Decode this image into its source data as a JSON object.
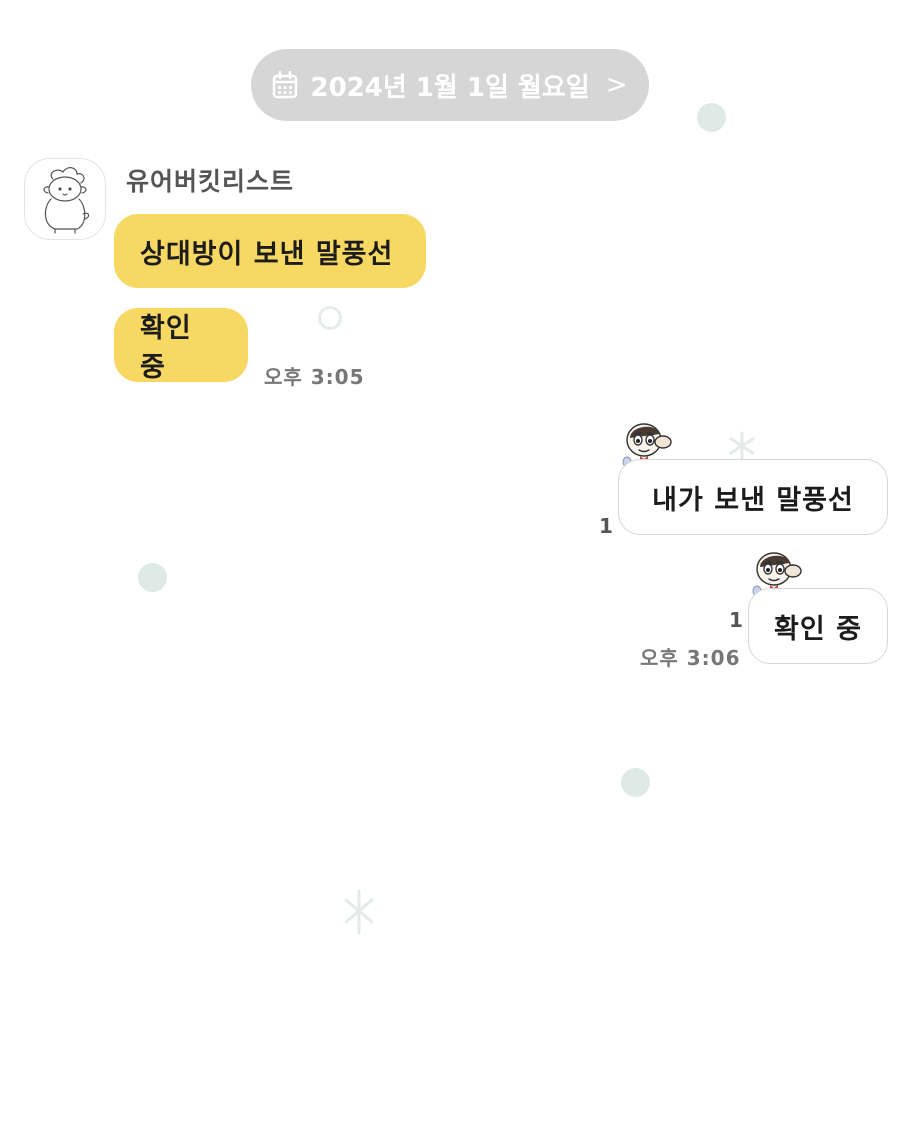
{
  "date_divider": {
    "label": "2024년 1월 1일 월요일",
    "chevron": ">",
    "icon": "calendar-icon",
    "bg_color": "#d6d6d6"
  },
  "incoming": {
    "sender_name": "유어버킷리스트",
    "avatar_icon": "sheep-sketch-avatar",
    "bubble_color": "#f6d862",
    "messages": [
      {
        "text": "상대방이 보낸 말풍선"
      },
      {
        "text": "확인 중"
      }
    ],
    "time": "오후 3:05"
  },
  "outgoing": {
    "sticker_icon": "cartoon-boy-sticker",
    "bubble_color": "#ffffff",
    "messages": [
      {
        "text": "내가 보낸 말풍선",
        "unread": "1"
      },
      {
        "text": "확인 중",
        "unread": "1"
      }
    ],
    "time": "오후 3:06"
  }
}
